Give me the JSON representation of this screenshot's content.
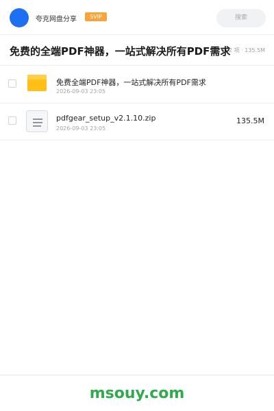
{
  "header": {
    "app_name": "夸克网盘分享",
    "badge": "SVIP",
    "search_placeholder": "搜索",
    "avatar_color": "#1f6ff2"
  },
  "share": {
    "title": "免费的全端PDF神器，一站式解决所有PDF需求",
    "meta": "共 2 项 · 135.5M"
  },
  "files": [
    {
      "icon": "folder-icon",
      "name": "免费全端PDF神器，一站式解决所有PDF需求",
      "date": "2026-09-03 23:05",
      "size": ""
    },
    {
      "icon": "zip-file-icon",
      "name": "pdfgear_setup_v2.1.10.zip",
      "date": "2026-09-03 23:05",
      "size": "135.5M"
    }
  ],
  "footer": {
    "brand": "msouy.com",
    "brand_color": "#2faa4c"
  },
  "colors": {
    "svip": "#f7a53a",
    "folder": "#ffbf17"
  }
}
